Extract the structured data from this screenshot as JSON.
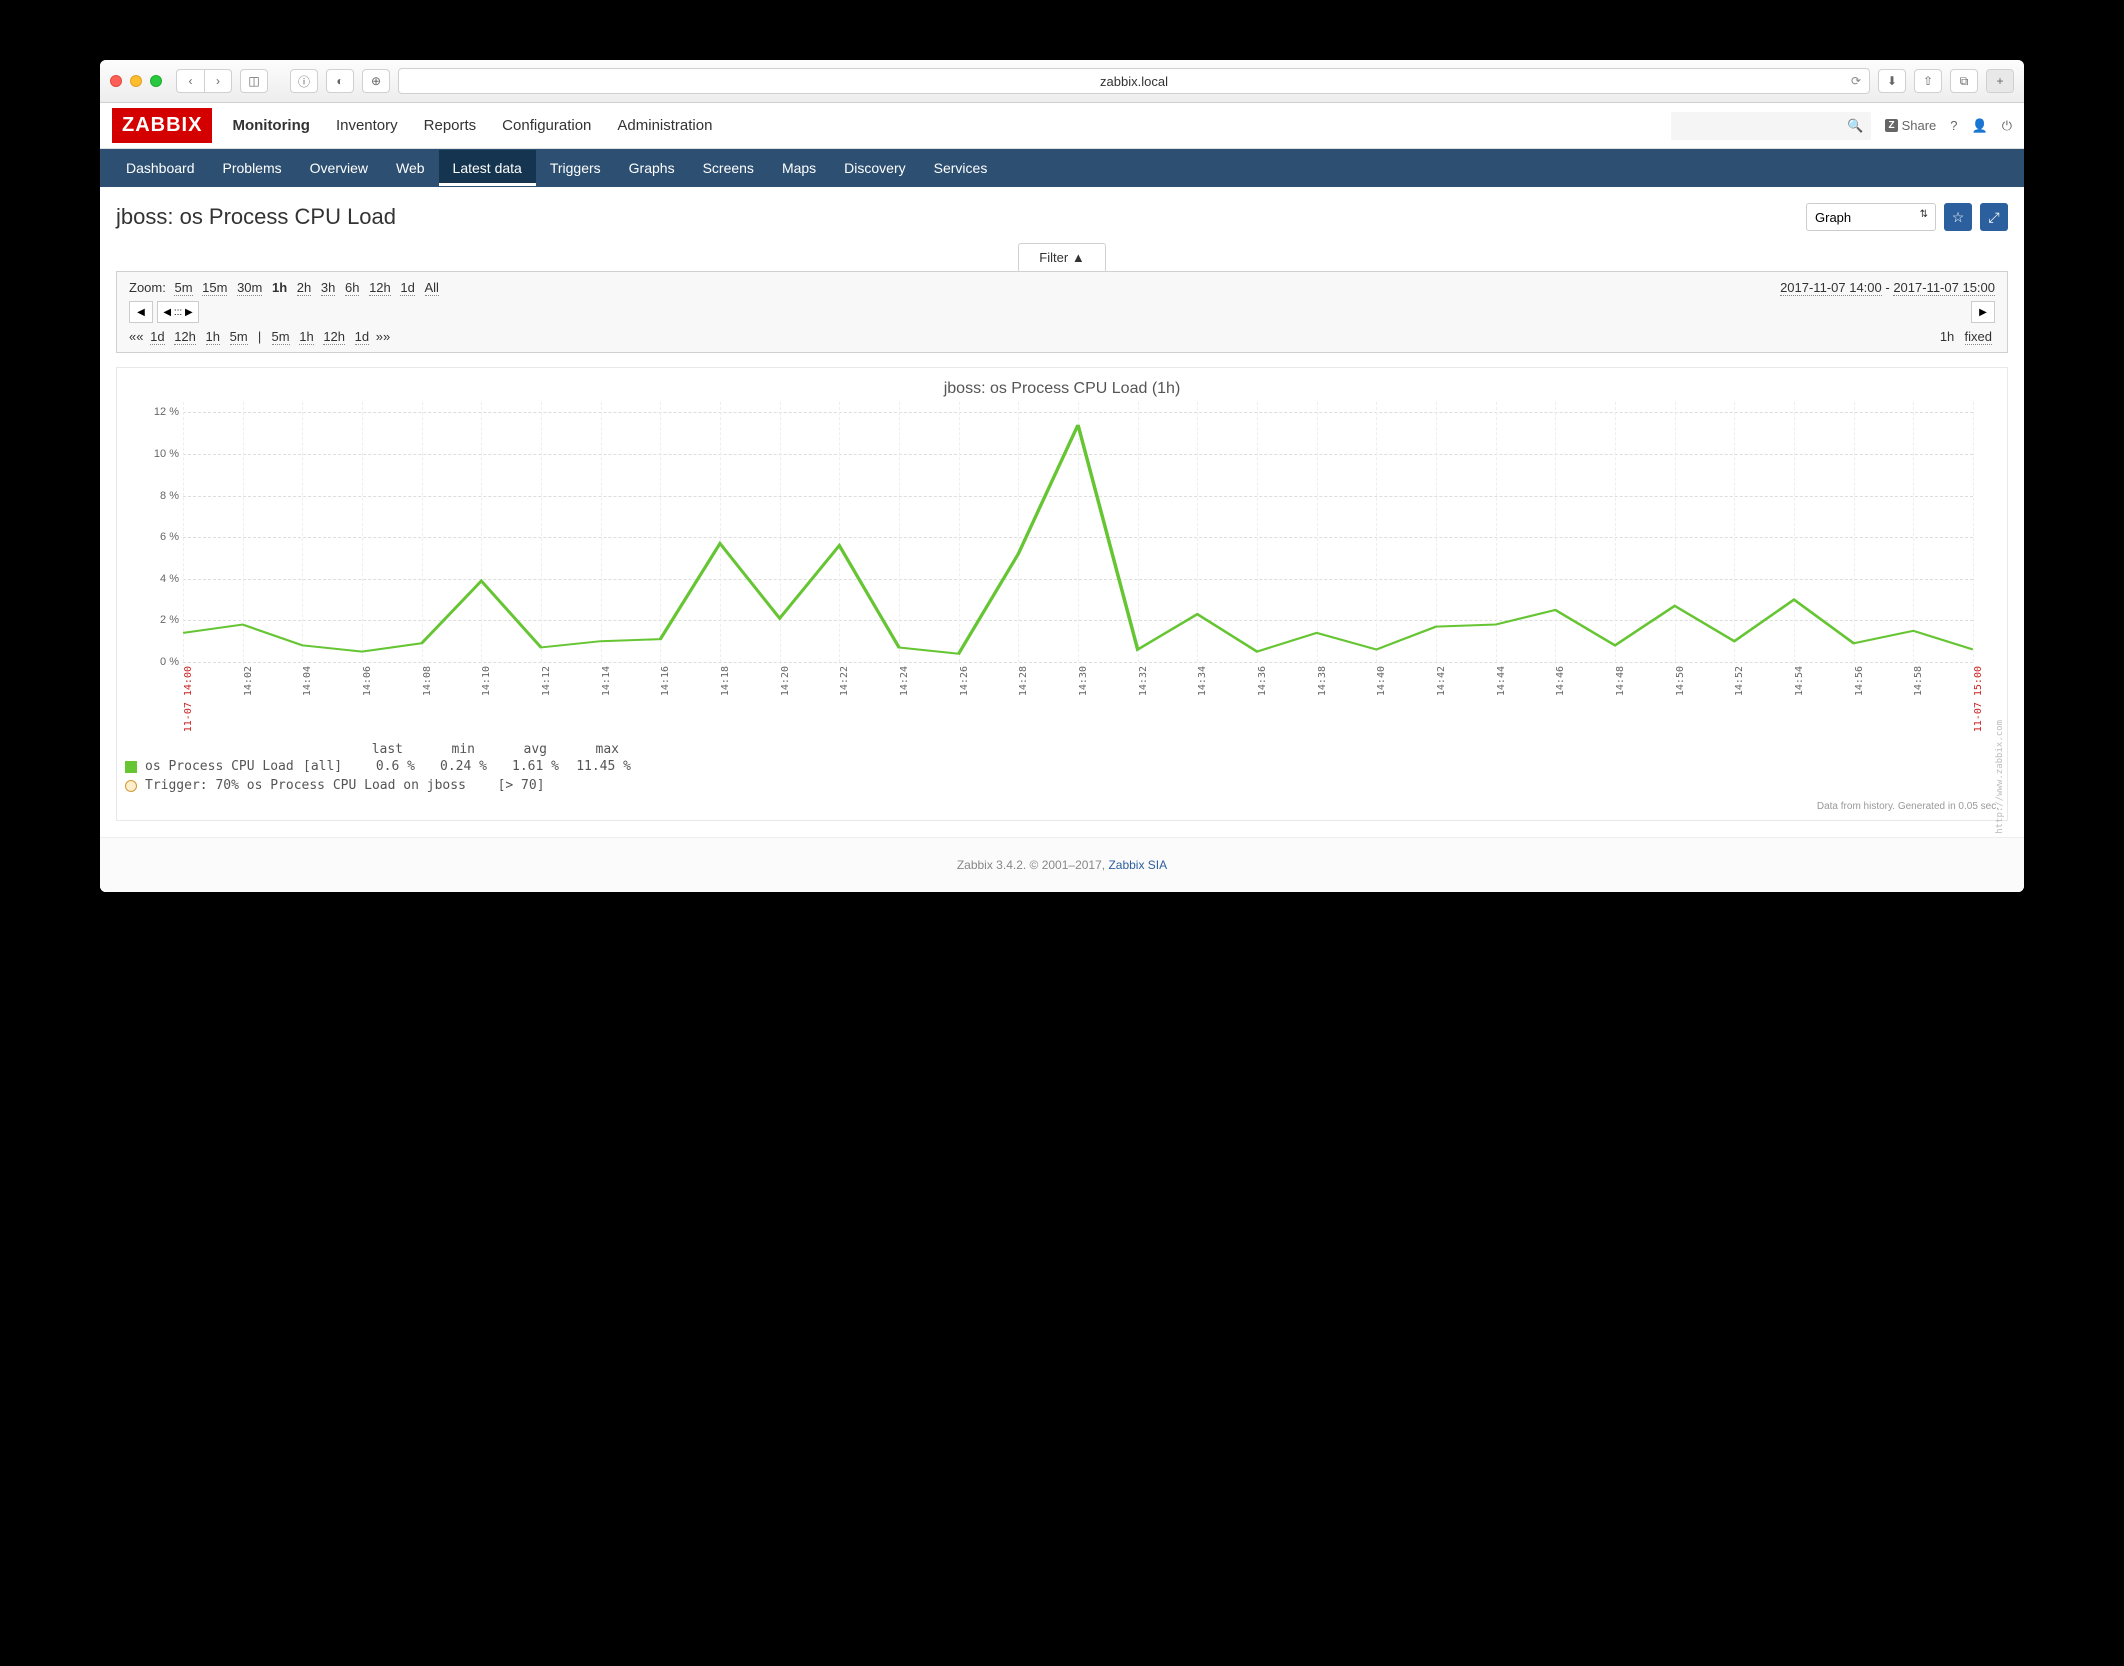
{
  "browser": {
    "url": "zabbix.local"
  },
  "header": {
    "logo": "ZABBIX",
    "nav": [
      "Monitoring",
      "Inventory",
      "Reports",
      "Configuration",
      "Administration"
    ],
    "active_nav": "Monitoring",
    "share_label": "Share"
  },
  "subnav": {
    "items": [
      "Dashboard",
      "Problems",
      "Overview",
      "Web",
      "Latest data",
      "Triggers",
      "Graphs",
      "Screens",
      "Maps",
      "Discovery",
      "Services"
    ],
    "active": "Latest data"
  },
  "page": {
    "title": "jboss: os Process CPU Load",
    "view_mode": "Graph",
    "filter_label": "Filter",
    "filter_arrow": "▲"
  },
  "time_selector": {
    "zoom_label": "Zoom:",
    "zoom_items": [
      "5m",
      "15m",
      "30m",
      "1h",
      "2h",
      "3h",
      "6h",
      "12h",
      "1d",
      "All"
    ],
    "zoom_active": "1h",
    "range_from": "2017-11-07 14:00",
    "range_to": "2017-11-07 15:00",
    "shift_back": [
      "1d",
      "12h",
      "1h",
      "5m"
    ],
    "shift_fwd": [
      "5m",
      "1h",
      "12h",
      "1d"
    ],
    "current_zoom": "1h",
    "fixed_label": "fixed"
  },
  "chart_data": {
    "type": "line",
    "title": "jboss: os Process CPU Load (1h)",
    "ylabel": "",
    "ylim": [
      0,
      12.5
    ],
    "yticks": [
      0,
      2,
      4,
      6,
      8,
      10,
      12
    ],
    "ytick_suffix": " %",
    "xlabel_prefix": "11-07 ",
    "xstart_red": "14:00",
    "xend_red": "15:00",
    "categories": [
      "14:00",
      "14:02",
      "14:04",
      "14:06",
      "14:08",
      "14:10",
      "14:12",
      "14:14",
      "14:16",
      "14:18",
      "14:20",
      "14:22",
      "14:24",
      "14:26",
      "14:28",
      "14:30",
      "14:32",
      "14:34",
      "14:36",
      "14:38",
      "14:40",
      "14:42",
      "14:44",
      "14:46",
      "14:48",
      "14:50",
      "14:52",
      "14:54",
      "14:56",
      "14:58",
      "15:00"
    ],
    "series": [
      {
        "name": "os Process CPU Load",
        "color": "#66c533",
        "values": [
          1.4,
          1.8,
          0.8,
          0.5,
          0.9,
          3.9,
          0.7,
          1.0,
          1.1,
          5.7,
          2.1,
          5.6,
          0.7,
          0.4,
          5.2,
          11.4,
          0.6,
          2.3,
          0.5,
          1.4,
          0.6,
          1.7,
          1.8,
          2.5,
          0.8,
          2.7,
          1.0,
          3.0,
          0.9,
          1.5,
          0.6
        ]
      }
    ],
    "legend": {
      "scope": "[all]",
      "columns": [
        "last",
        "min",
        "avg",
        "max"
      ],
      "values": [
        "0.6 %",
        "0.24 %",
        "1.61 %",
        "11.45 %"
      ],
      "trigger_label": "Trigger: 70% os Process CPU Load on jboss",
      "trigger_cond": "[> 70]",
      "trigger_color": "#ffeecc"
    },
    "footer": "Data from history. Generated in 0.05 sec.",
    "watermark": "http://www.zabbix.com"
  },
  "footer": {
    "text": "Zabbix 3.4.2. © 2001–2017, ",
    "link_text": "Zabbix SIA"
  }
}
